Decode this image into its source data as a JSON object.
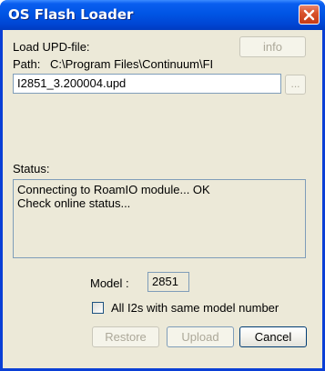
{
  "window": {
    "title": "OS Flash Loader"
  },
  "load_section": {
    "label": "Load UPD-file:",
    "info_button": "info",
    "path_label": "Path:",
    "path_value": "C:\\Program Files\\Continuum\\FI",
    "file_value": "I2851_3.200004.upd",
    "browse_button": "..."
  },
  "status_section": {
    "label": "Status:",
    "lines": [
      "Connecting to RoamIO module... OK",
      "Check online status..."
    ]
  },
  "model": {
    "label": "Model :",
    "value": "2851"
  },
  "checkbox": {
    "label": "All I2s with same model number",
    "checked": false
  },
  "buttons": {
    "restore": "Restore",
    "upload": "Upload",
    "cancel": "Cancel"
  },
  "colors": {
    "titlebar": "#0055e5",
    "window_bg": "#ece9d8",
    "close_button": "#d9542e",
    "disabled_text": "#aca899"
  }
}
